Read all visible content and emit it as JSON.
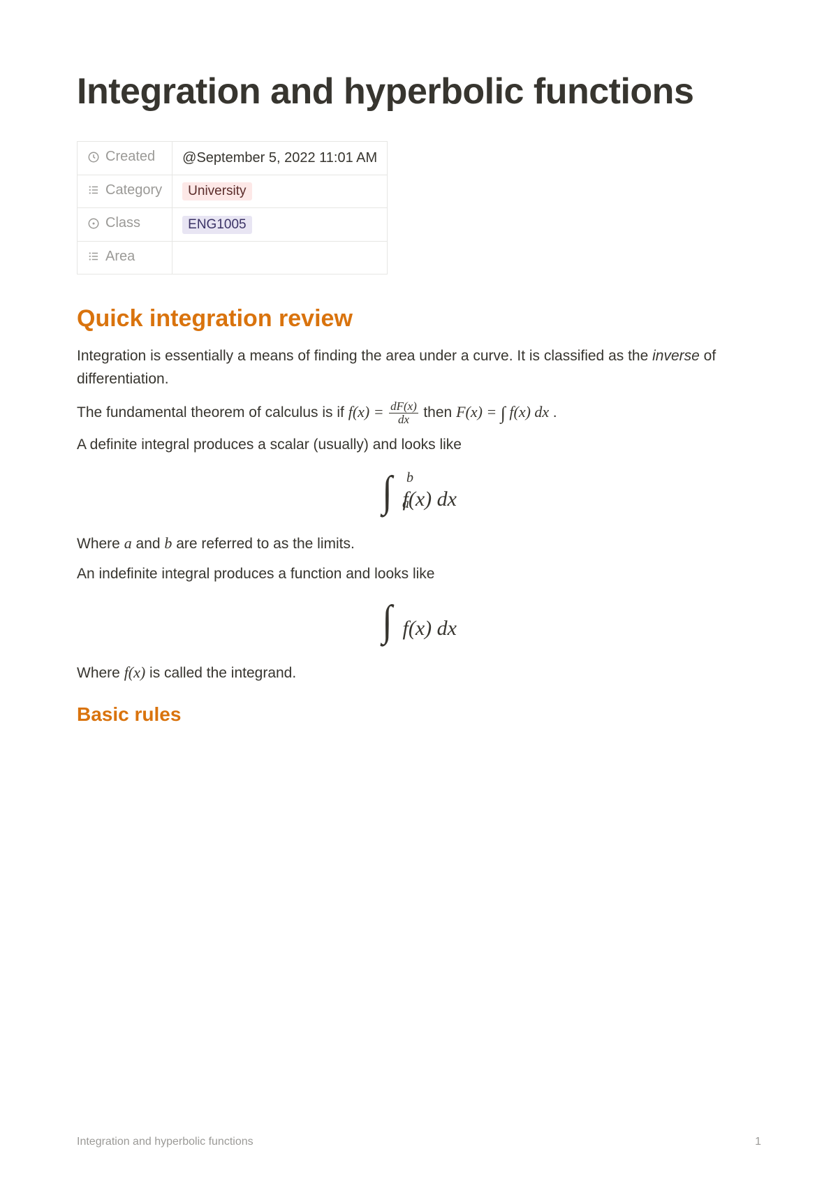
{
  "title": "Integration and hyperbolic functions",
  "properties": {
    "created": {
      "label": "Created",
      "value": "@September 5, 2022 11:01 AM"
    },
    "category": {
      "label": "Category",
      "value": "University",
      "bg": "#fde8e7",
      "fg": "#5a2b29"
    },
    "class": {
      "label": "Class",
      "value": "ENG1005",
      "bg": "#e8e5f3",
      "fg": "#3b3366"
    },
    "area": {
      "label": "Area",
      "value": ""
    }
  },
  "sections": {
    "review_heading": "Quick integration review",
    "p1a": "Integration is essentially a means of finding the area under a curve. It is classified as the ",
    "p1b": "inverse",
    "p1c": " of differentiation.",
    "p2a": "The fundamental theorem of calculus is if ",
    "p2b": " then ",
    "p2c": ".",
    "p3": "A definite integral produces a scalar (usually) and looks like",
    "p4a": "Where ",
    "p4b": " and ",
    "p4c": " are referred to as the limits.",
    "p5": "An indefinite integral produces a function and looks like",
    "p6a": "Where ",
    "p6b": " is called the integrand.",
    "rules_heading": "Basic rules"
  },
  "math": {
    "fx_eq": "f(x) = ",
    "frac_num": "dF(x)",
    "frac_den": "dx",
    "Fx_eq": "F(x) = ",
    "int_fx_dx": " f(x) dx",
    "a": "a",
    "b": "b",
    "fx": "f(x)",
    "fx_dx": "f(x) dx"
  },
  "footer": {
    "title": "Integration and hyperbolic functions",
    "page": "1"
  }
}
